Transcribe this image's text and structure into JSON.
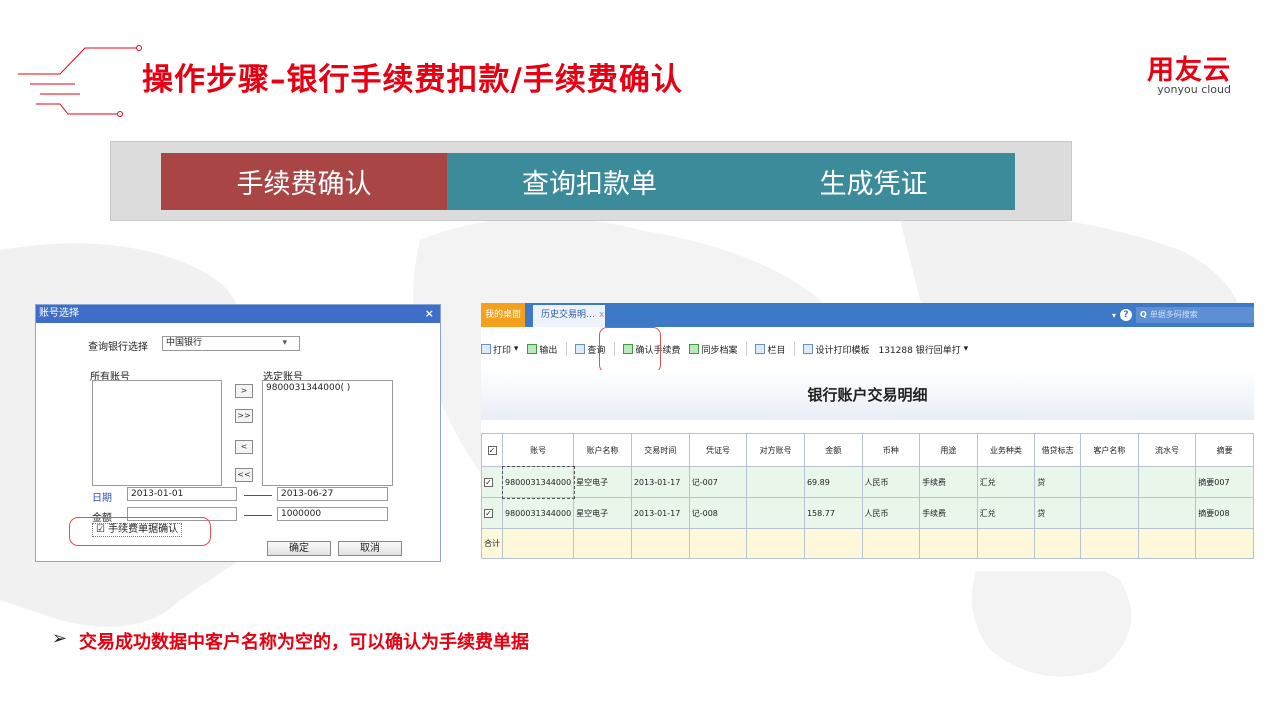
{
  "header": {
    "title": "操作步骤–银行手续费扣款/手续费确认",
    "logo_zh": "用友云",
    "logo_en": "yonyou cloud"
  },
  "steps": [
    "手续费确认",
    "查询扣款单",
    "生成凭证"
  ],
  "colors": {
    "accent": "#e60012",
    "step_active": "#a94645",
    "step": "#3b8b9a"
  },
  "dialog": {
    "title": "账号选择",
    "close": "×",
    "bank_label": "查询银行选择",
    "bank_value": "中国银行",
    "bank_dropdown": "▾",
    "all_accounts_label": "所有账号",
    "selected_accounts_label": "选定账号",
    "selected_account": "9800031344000( )",
    "move_right": ">",
    "move_all_right": ">>",
    "move_left": "<",
    "move_all_left": "<<",
    "date_label": "日期",
    "date_from": "2013-01-01",
    "date_to": "2013-06-27",
    "amount_label": "金额",
    "amount_from": "",
    "amount_to": "1000000",
    "confirm_checkbox_mark": "☑",
    "confirm_checkbox_label": "手续费单据确认",
    "ok": "确定",
    "cancel": "取消"
  },
  "app": {
    "tabs": {
      "home": "我的桌面",
      "history": "历史交易明…",
      "close": "x"
    },
    "help": "?",
    "search_placeholder": "单据多码搜索",
    "toolbar": [
      "打印",
      "输出",
      "查询",
      "确认手续费",
      "同步档案",
      "栏目",
      "设计打印模板",
      "131288 银行回单打"
    ],
    "report_title": "银行账户交易明细",
    "columns": [
      "账号",
      "账户名称",
      "交易时间",
      "凭证号",
      "对方账号",
      "金额",
      "币种",
      "用途",
      "业务种类",
      "借贷标志",
      "客户名称",
      "流水号",
      "摘要"
    ],
    "rows": [
      [
        "9800031344000",
        "星空电子",
        "2013-01-17",
        "记-007",
        "",
        "69.89",
        "人民币",
        "手续费",
        "汇兑",
        "贷",
        "",
        "",
        "摘要007"
      ],
      [
        "9800031344000",
        "星空电子",
        "2013-01-17",
        "记-008",
        "",
        "158.77",
        "人民币",
        "手续费",
        "汇兑",
        "贷",
        "",
        "",
        "摘要008"
      ]
    ],
    "total_label": "合计"
  },
  "note": "交易成功数据中客户名称为空的，可以确认为手续费单据",
  "note_marker": "➢"
}
